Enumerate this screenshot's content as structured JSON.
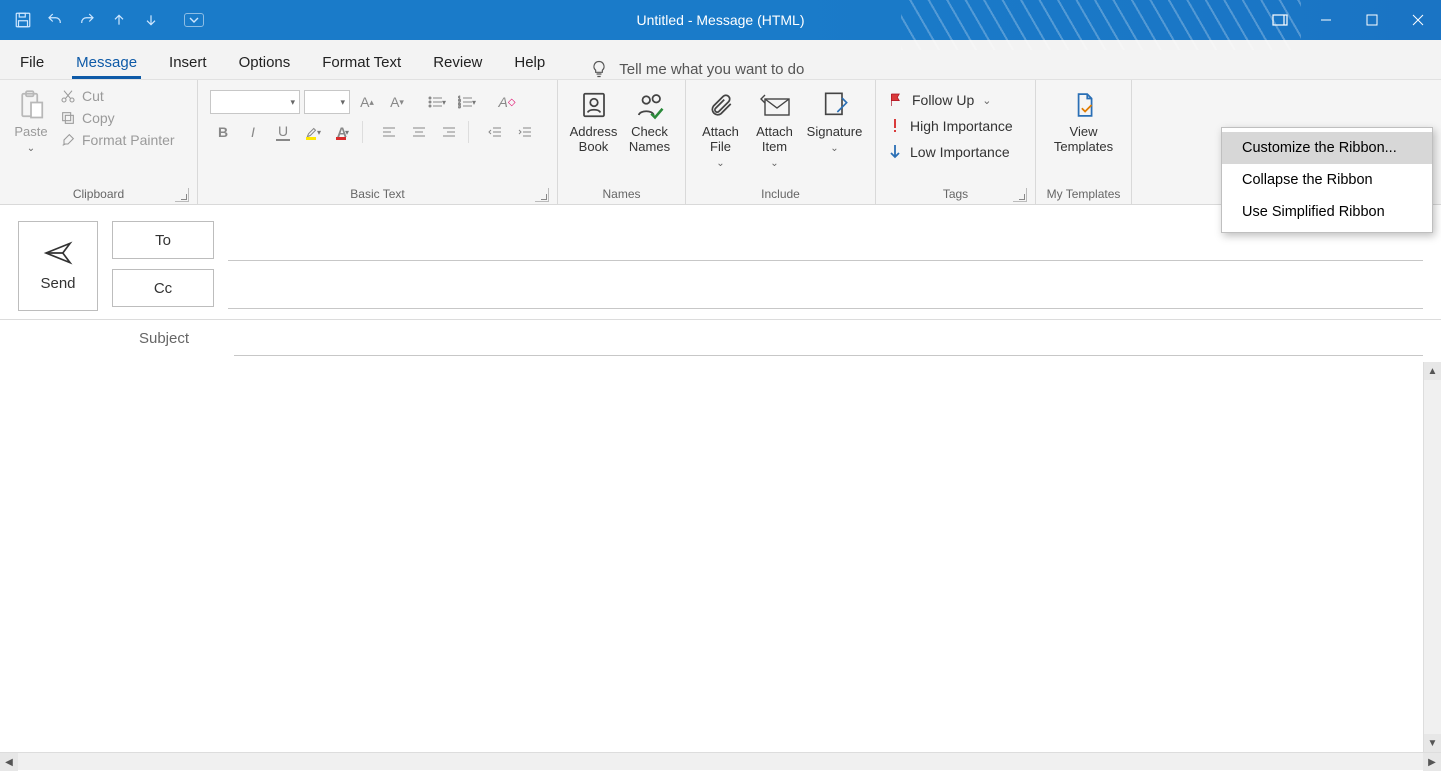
{
  "title": "Untitled  -  Message (HTML)",
  "tabs": {
    "file": "File",
    "message": "Message",
    "insert": "Insert",
    "options": "Options",
    "format_text": "Format Text",
    "review": "Review",
    "help": "Help"
  },
  "tellme": "Tell me what you want to do",
  "clipboard": {
    "paste": "Paste",
    "cut": "Cut",
    "copy": "Copy",
    "format_painter": "Format Painter",
    "label": "Clipboard"
  },
  "basic_text": {
    "label": "Basic Text"
  },
  "names": {
    "address_book": "Address Book",
    "check_names": "Check Names",
    "label": "Names"
  },
  "include": {
    "attach_file": "Attach File",
    "attach_item": "Attach Item",
    "signature": "Signature",
    "label": "Include"
  },
  "tags": {
    "follow_up": "Follow Up",
    "high": "High Importance",
    "low": "Low Importance",
    "label": "Tags"
  },
  "mytemplates": {
    "view": "View Templates",
    "label": "My Templates"
  },
  "compose": {
    "send": "Send",
    "to": "To",
    "cc": "Cc",
    "subject": "Subject"
  },
  "context_menu": {
    "customize": "Customize the Ribbon...",
    "collapse": "Collapse the Ribbon",
    "simplified": "Use Simplified Ribbon"
  }
}
